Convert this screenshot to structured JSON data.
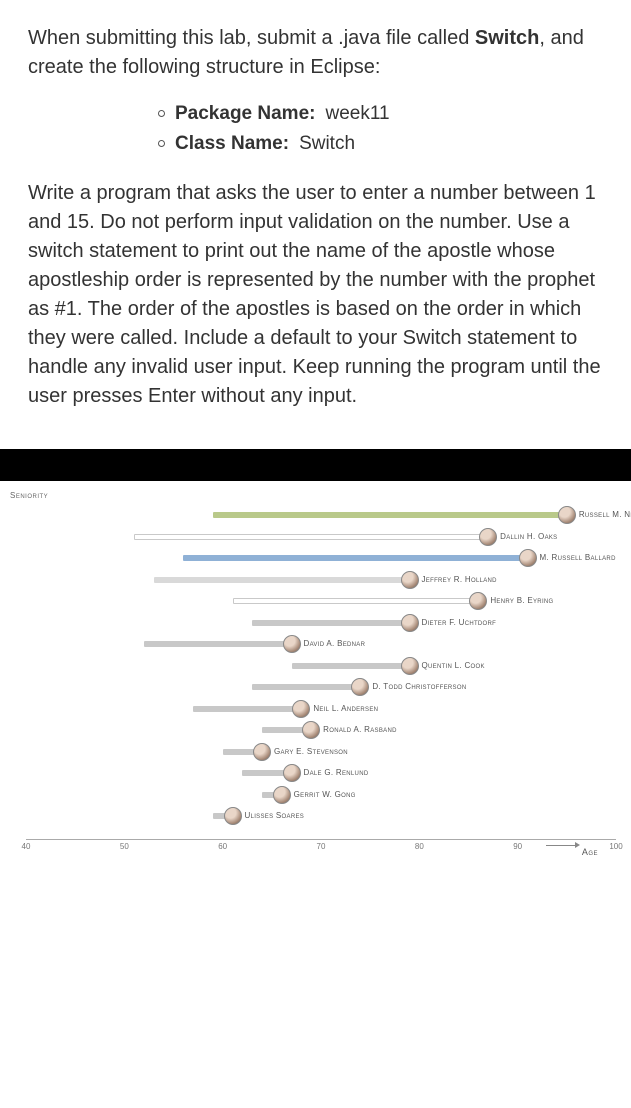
{
  "instructions": {
    "p1_a": "When submitting this lab, submit a .java file called ",
    "p1_b": "Switch",
    "p1_c": ", and create the following structure in Eclipse:",
    "bul_pkg_lbl": "Package Name:",
    "bul_pkg_val": "week11",
    "bul_cls_lbl": "Class Name:",
    "bul_cls_val": "Switch",
    "p2": "Write a program that asks the user to enter a number between 1 and 15. Do not perform input validation on the number. Use a switch statement to print out the name of the apostle whose apostleship order is represented by the number with the prophet as #1. The order of the apostles is based on the order in which they were called. Include a default to your Switch statement to handle any invalid user input. Keep running the program until the user presses Enter without any input."
  },
  "chart_data": {
    "type": "bar",
    "title": "",
    "xlabel": "Age",
    "ylabel": "Seniority",
    "xlim": [
      40,
      100
    ],
    "ticks": [
      40,
      50,
      60,
      70,
      80,
      90,
      100
    ],
    "series": [
      {
        "name": "Russell M. Nelson",
        "start": 59,
        "end": 95,
        "class": "solid1"
      },
      {
        "name": "Dallin H. Oaks",
        "start": 51,
        "end": 87,
        "class": "outline"
      },
      {
        "name": "M. Russell Ballard",
        "start": 56,
        "end": 91,
        "class": "solid2"
      },
      {
        "name": "Jeffrey R. Holland",
        "start": 53,
        "end": 79,
        "class": "solid3"
      },
      {
        "name": "Henry B. Eyring",
        "start": 61,
        "end": 86,
        "class": "outline"
      },
      {
        "name": "Dieter F. Uchtdorf",
        "start": 63,
        "end": 79,
        "class": "gray"
      },
      {
        "name": "David A. Bednar",
        "start": 52,
        "end": 67,
        "class": "gray"
      },
      {
        "name": "Quentin L. Cook",
        "start": 67,
        "end": 79,
        "class": "gray"
      },
      {
        "name": "D. Todd Christofferson",
        "start": 63,
        "end": 74,
        "class": "gray"
      },
      {
        "name": "Neil L. Andersen",
        "start": 57,
        "end": 68,
        "class": "gray"
      },
      {
        "name": "Ronald A. Rasband",
        "start": 64,
        "end": 69,
        "class": "gray"
      },
      {
        "name": "Gary E. Stevenson",
        "start": 60,
        "end": 64,
        "class": "gray"
      },
      {
        "name": "Dale G. Renlund",
        "start": 62,
        "end": 67,
        "class": "gray"
      },
      {
        "name": "Gerrit W. Gong",
        "start": 64,
        "end": 66,
        "class": "gray"
      },
      {
        "name": "Ulisses Soares",
        "start": 59,
        "end": 61,
        "class": "gray"
      }
    ]
  }
}
